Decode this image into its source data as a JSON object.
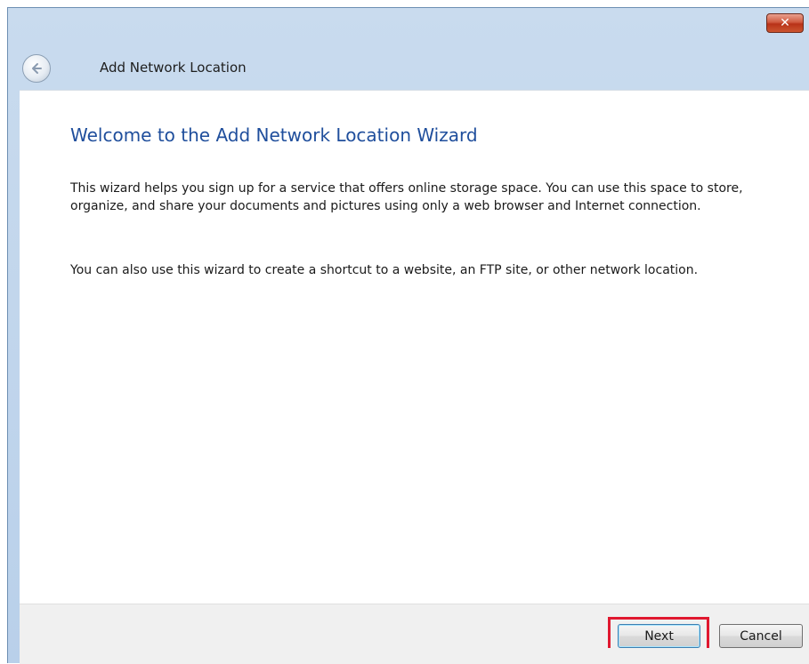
{
  "window": {
    "title": "Add Network Location",
    "close_label": "✕"
  },
  "wizard": {
    "heading": "Welcome to the Add Network Location Wizard",
    "paragraph1": "This wizard helps you sign up for a service that offers online storage space.  You can use this space to store, organize, and share your documents and pictures using only a web browser and Internet connection.",
    "paragraph2": "You can also use this wizard to create a shortcut to a website, an FTP site, or other network location."
  },
  "footer": {
    "next_label": "Next",
    "cancel_label": "Cancel"
  },
  "colors": {
    "heading": "#1f4e9c",
    "highlight": "#e0182f",
    "titlebar": "#c9dbee"
  },
  "icons": {
    "back": "back-arrow-icon",
    "close": "close-icon"
  }
}
